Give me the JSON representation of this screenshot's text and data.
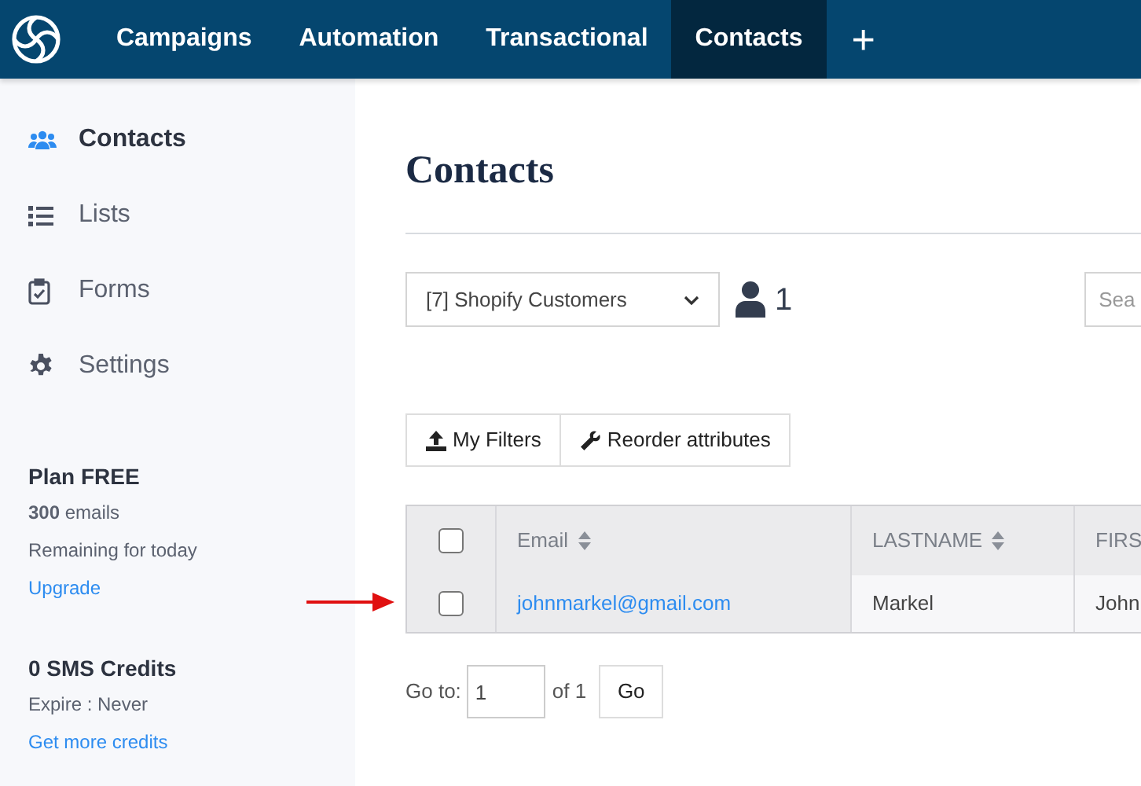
{
  "nav": {
    "tabs": [
      {
        "label": "Campaigns",
        "selected": false
      },
      {
        "label": "Automation",
        "selected": false
      },
      {
        "label": "Transactional",
        "selected": false
      },
      {
        "label": "Contacts",
        "selected": true
      }
    ],
    "add": "+"
  },
  "sidebar": {
    "items": [
      {
        "label": "Contacts",
        "selected": true
      },
      {
        "label": "Lists",
        "selected": false
      },
      {
        "label": "Forms",
        "selected": false
      },
      {
        "label": "Settings",
        "selected": false
      }
    ],
    "plan": {
      "title": "Plan FREE",
      "emails": "**300** emails",
      "remaining": "Remaining for today",
      "link": "Upgrade"
    },
    "sms": {
      "title": "0 SMS Credits",
      "expire": "Expire : Never",
      "link": "Get more credits"
    }
  },
  "main": {
    "title": "Contacts",
    "list_select": "[7] Shopify Customers",
    "count": "1",
    "search": {
      "placeholder": "Sea"
    },
    "buttons": [
      {
        "label": "My Filters"
      },
      {
        "label": "Reorder attributes"
      }
    ],
    "table": {
      "columns": [
        {
          "label": "Email",
          "sortable": true
        },
        {
          "label": "LASTNAME",
          "sortable": true
        },
        {
          "label": "FIRS",
          "sortable": false
        }
      ],
      "select_all_checked": false,
      "rows": [
        {
          "checked": false,
          "email": "johnmarkel@gmail.com",
          "lastname": "Markel",
          "firstname": "John"
        }
      ]
    },
    "pagination": {
      "label": "Go to:",
      "page": "1",
      "of": "of 1",
      "button": "Go"
    }
  }
}
